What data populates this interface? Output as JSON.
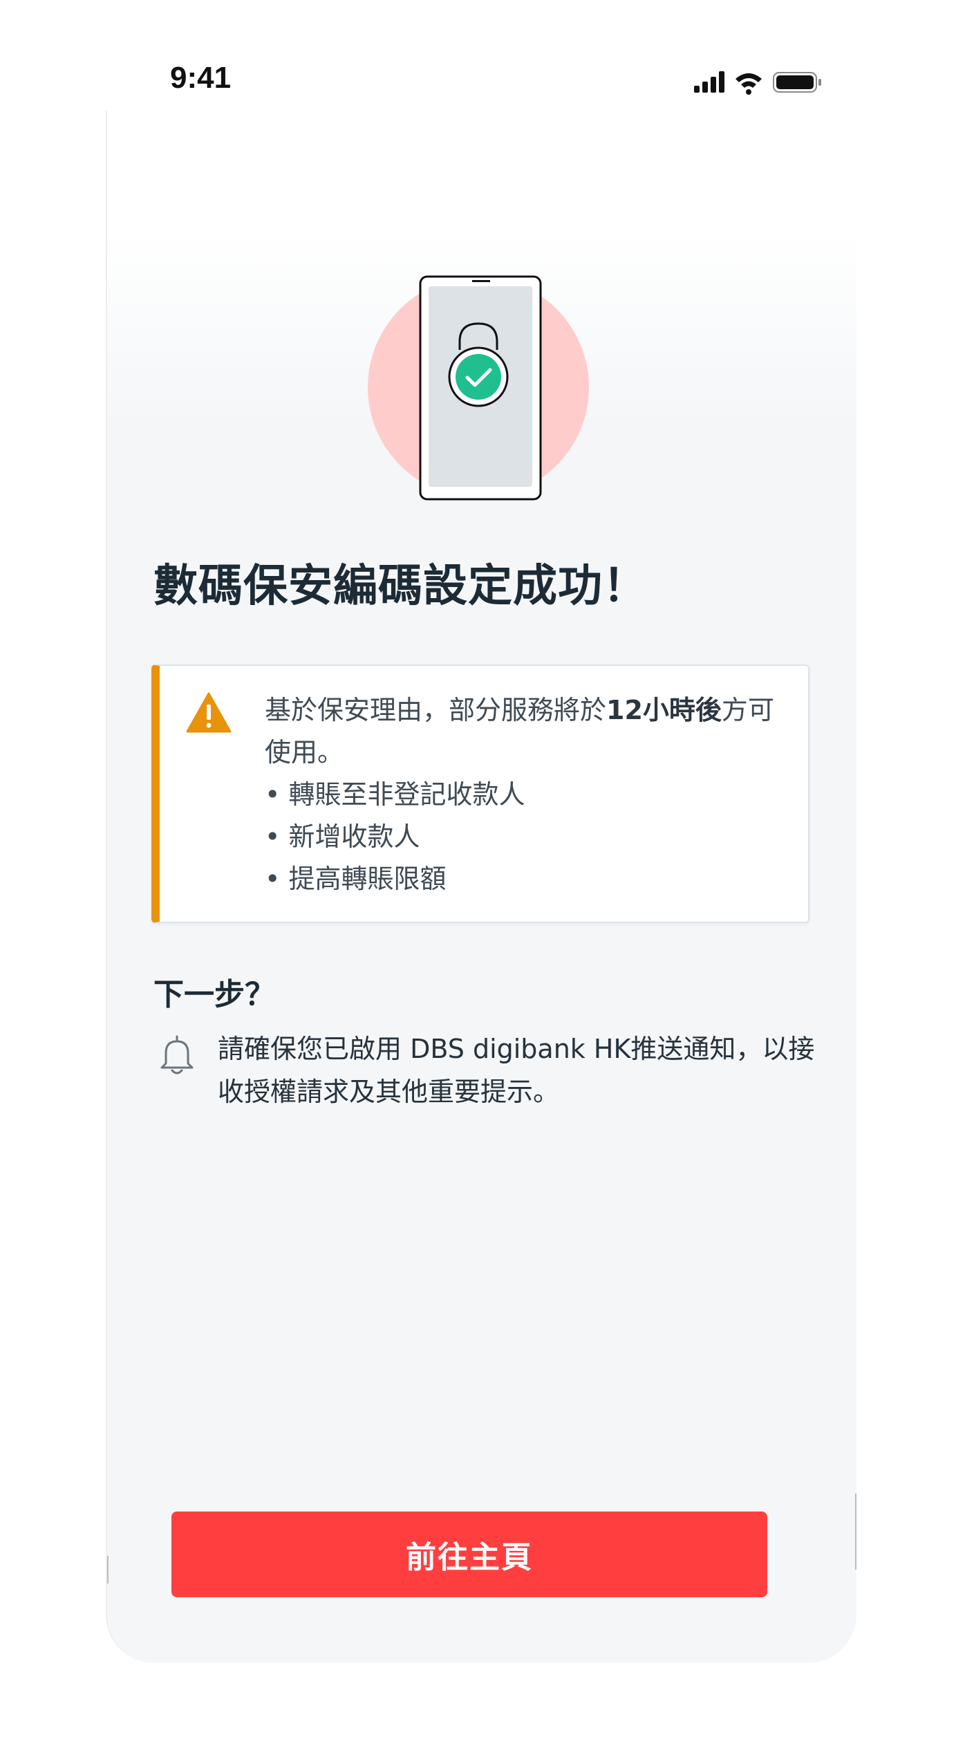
{
  "status_bar": {
    "time": "9:41",
    "icons": [
      "signal-icon",
      "wifi-icon",
      "battery-icon"
    ]
  },
  "main": {
    "illustration": "phone-lock-check-icon",
    "title": "數碼保安編碼設定成功！",
    "notice": {
      "icon": "warning-icon",
      "text_before": "基於保安理由，部分服務將於",
      "text_bold": "12小時後",
      "text_after": "方可使用。",
      "bullets": [
        "• 轉賬至非登記收款人",
        "• 新增收款人",
        "• 提高轉賬限額"
      ]
    },
    "next_step": {
      "heading": "下一步？",
      "icon": "bell-icon",
      "text": "請確保您已啟用 DBS digibank HK推送通知，以接收授權請求及其他重要提示。"
    }
  },
  "footer": {
    "primary_button_label": "前往主頁"
  },
  "colors": {
    "accent_red": "#ff3f3f",
    "warning_orange": "#e8930b",
    "success_green": "#1fbf8f",
    "title_text": "#1c2b36"
  }
}
